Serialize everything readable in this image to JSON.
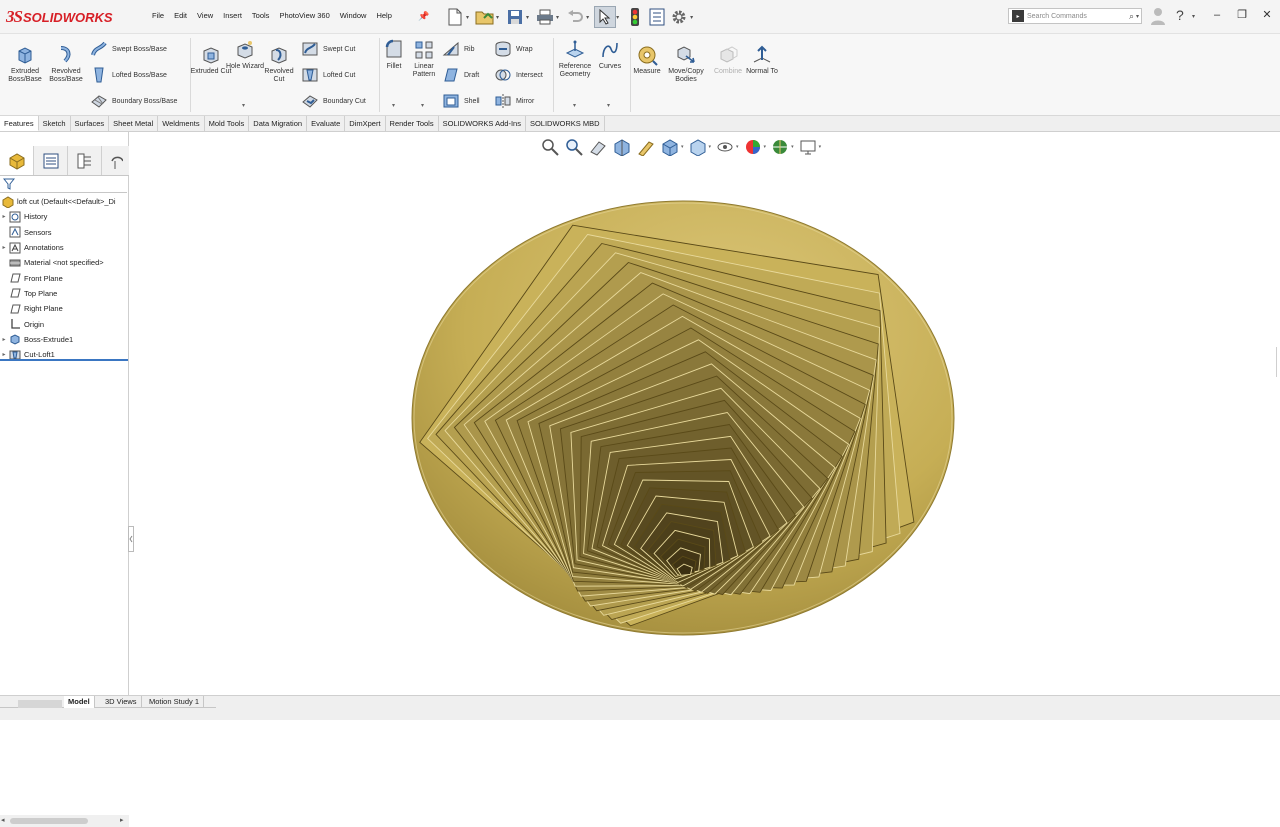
{
  "app": {
    "brand_prefix": "3S",
    "brand_name": "SOLIDWORKS"
  },
  "menu": [
    "File",
    "Edit",
    "View",
    "Insert",
    "Tools",
    "PhotoView 360",
    "Window",
    "Help"
  ],
  "search": {
    "placeholder": "Search Commands"
  },
  "ribbon": {
    "extruded_boss": "Extruded Boss/Base",
    "revolved_boss": "Revolved Boss/Base",
    "swept_boss": "Swept Boss/Base",
    "lofted_boss": "Lofted Boss/Base",
    "boundary_boss": "Boundary Boss/Base",
    "extruded_cut": "Extruded Cut",
    "hole_wizard": "Hole Wizard",
    "revolved_cut": "Revolved Cut",
    "swept_cut": "Swept Cut",
    "lofted_cut": "Lofted Cut",
    "boundary_cut": "Boundary Cut",
    "fillet": "Fillet",
    "linear_pattern": "Linear Pattern",
    "rib": "Rib",
    "draft": "Draft",
    "shell": "Shell",
    "wrap": "Wrap",
    "intersect": "Intersect",
    "mirror": "Mirror",
    "reference_geometry": "Reference Geometry",
    "curves": "Curves",
    "measure": "Measure",
    "move_copy": "Move/Copy Bodies",
    "combine": "Combine",
    "normal_to": "Normal To"
  },
  "tabs": [
    "Features",
    "Sketch",
    "Surfaces",
    "Sheet Metal",
    "Weldments",
    "Mold Tools",
    "Data Migration",
    "Evaluate",
    "DimXpert",
    "Render Tools",
    "SOLIDWORKS Add-Ins",
    "SOLIDWORKS MBD"
  ],
  "active_tab": "Features",
  "tree": {
    "root": "loft cut  (Default<<Default>_Di",
    "items": [
      "History",
      "Sensors",
      "Annotations",
      "Material <not specified>",
      "Front Plane",
      "Top Plane",
      "Right Plane",
      "Origin",
      "Boss-Extrude1",
      "Cut-Loft1"
    ]
  },
  "bottom_tabs": [
    "Model",
    "3D Views",
    "Motion Study 1"
  ],
  "active_bottom_tab": "Model",
  "colors": {
    "part_gold": "#c9b25a",
    "part_dark": "#6b5a22",
    "brand_red": "#d71f26",
    "accent_blue": "#3a76c2"
  }
}
